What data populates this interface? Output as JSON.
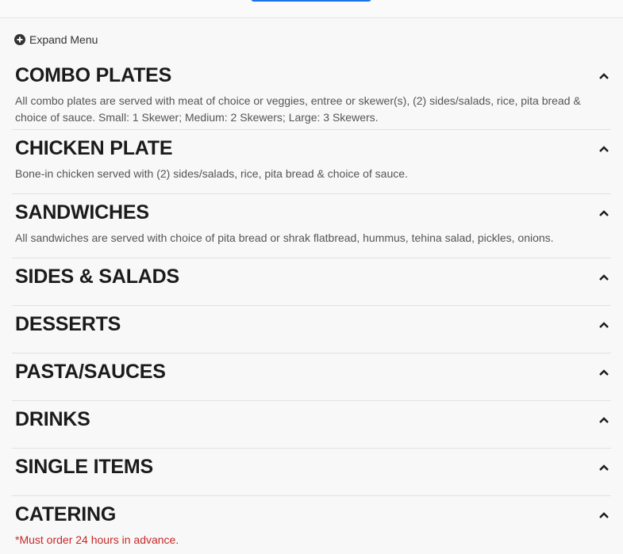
{
  "expand_menu": {
    "icon": "plus-circle-icon",
    "label": "Expand Menu"
  },
  "sections": [
    {
      "title": "COMBO PLATES",
      "description": "All combo plates are served with meat of choice or veggies, entree or skewer(s), (2) sides/salads, rice, pita bread & choice of sauce. Small: 1 Skewer; Medium: 2 Skewers; Large: 3 Skewers.",
      "icon": "chevron-up-icon"
    },
    {
      "title": "CHICKEN PLATE",
      "description": "Bone-in chicken served with (2) sides/salads, rice, pita bread & choice of sauce.",
      "icon": "chevron-up-icon"
    },
    {
      "title": "SANDWICHES",
      "description": "All sandwiches are served with choice of pita bread or shrak flatbread, hummus, tehina salad, pickles, onions.",
      "icon": "chevron-up-icon"
    },
    {
      "title": "SIDES & SALADS",
      "description": "",
      "icon": "chevron-up-icon"
    },
    {
      "title": "DESSERTS",
      "description": "",
      "icon": "chevron-up-icon"
    },
    {
      "title": "PASTA/SAUCES",
      "description": "",
      "icon": "chevron-up-icon"
    },
    {
      "title": "DRINKS",
      "description": "",
      "icon": "chevron-up-icon"
    },
    {
      "title": "SINGLE ITEMS",
      "description": "",
      "icon": "chevron-up-icon"
    },
    {
      "title": "CATERING",
      "description": "*Must order 24 hours in advance.",
      "icon": "chevron-up-icon"
    }
  ],
  "colors": {
    "accent": "#1a73e8",
    "notice": "#c62828"
  }
}
